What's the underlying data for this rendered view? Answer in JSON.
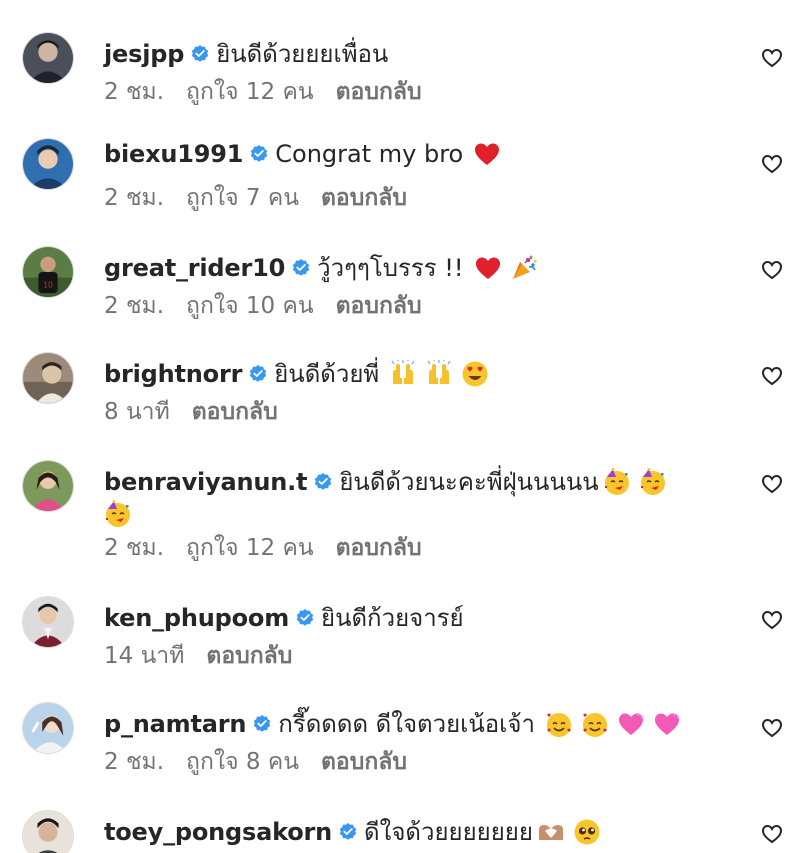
{
  "comments": [
    {
      "username": "jesjpp",
      "text": "ยินดีด้วยยยเพื่อน",
      "emojis": [],
      "time": "2 ชม.",
      "likes": "ถูกใจ 12 คน",
      "reply": "ตอบกลับ",
      "avatar_colors": [
        "#3a3f4b",
        "#c9b8a6"
      ]
    },
    {
      "username": "biexu1991",
      "text": "Congrat my bro",
      "emojis": [
        "red-heart-icon"
      ],
      "time": "2 ชม.",
      "likes": "ถูกใจ 7 คน",
      "reply": "ตอบกลับ",
      "avatar_colors": [
        "#2f6fb0",
        "#e8cbb0"
      ]
    },
    {
      "username": "great_rider10",
      "text": "วู้วๆๆโบรรร !!",
      "emojis": [
        "red-heart-icon",
        "party-popper-icon"
      ],
      "time": "2 ชม.",
      "likes": "ถูกใจ 10 คน",
      "reply": "ตอบกลับ",
      "avatar_colors": [
        "#4f6b3a",
        "#1c1c1c"
      ]
    },
    {
      "username": "brightnorr",
      "text": "ยินดีด้วยพี่",
      "emojis": [
        "raising-hands-icon",
        "raising-hands-icon",
        "heart-eyes-icon"
      ],
      "time": "8 นาที",
      "likes": "",
      "reply": "ตอบกลับ",
      "avatar_colors": [
        "#8a7b6a",
        "#d8c2a8"
      ]
    },
    {
      "username": "benraviyanun.t",
      "text": "ยินดีด้วยนะคะพี่ฝุ่นนนนน",
      "emojis": [
        "partying-face-icon",
        "partying-face-icon"
      ],
      "wrap_emojis": [
        "partying-face-icon"
      ],
      "time": "2 ชม.",
      "likes": "ถูกใจ 12 คน",
      "reply": "ตอบกลับ",
      "avatar_colors": [
        "#6d8a4c",
        "#e45a8a"
      ]
    },
    {
      "username": "ken_phupoom",
      "text": "ยินดีก้วยจารย์",
      "emojis": [],
      "time": "14 นาที",
      "likes": "",
      "reply": "ตอบกลับ",
      "avatar_colors": [
        "#d9d9d9",
        "#7a1f2b"
      ]
    },
    {
      "username": "p_namtarn",
      "text": "กรี๊ดดดด ดีใจตวยเน้อเจ้า",
      "emojis": [
        "smiling-hearts-icon",
        "smiling-hearts-icon",
        "pink-heart-icon",
        "pink-heart-icon"
      ],
      "time": "2 ชม.",
      "likes": "ถูกใจ 8 คน",
      "reply": "ตอบกลับ",
      "avatar_colors": [
        "#b9d4e8",
        "#f1e3d6"
      ]
    },
    {
      "username": "toey_pongsakorn",
      "text": "ดีใจด้วยยยยยยย",
      "emojis": [
        "heart-hands-icon",
        "pleading-face-icon"
      ],
      "time": "",
      "likes": "",
      "reply": "",
      "avatar_colors": [
        "#3b3b3b",
        "#d6b49a"
      ]
    }
  ],
  "colors": {
    "username": "#262626",
    "meta": "#737373",
    "verified": "#3897f0",
    "heart_outline": "#262626"
  }
}
